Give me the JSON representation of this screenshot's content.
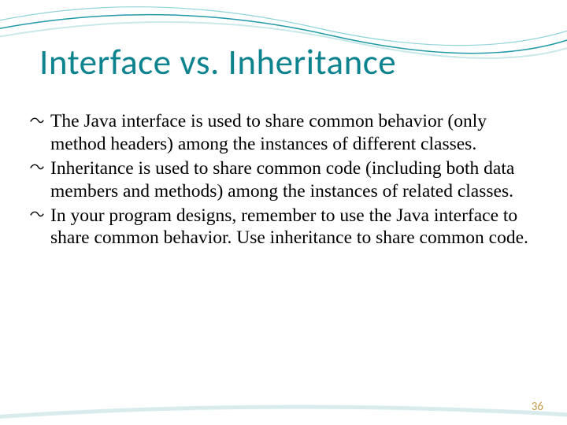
{
  "title": "Interface vs. Inheritance",
  "bullets": [
    "The Java interface is used to share common behavior (only method headers) among the instances of different classes.",
    "Inheritance is used to share common code (including both data members and methods) among the instances of related classes.",
    "In your program designs, remember to use the Java interface to share common behavior. Use inheritance to share common code."
  ],
  "page_number": "36"
}
